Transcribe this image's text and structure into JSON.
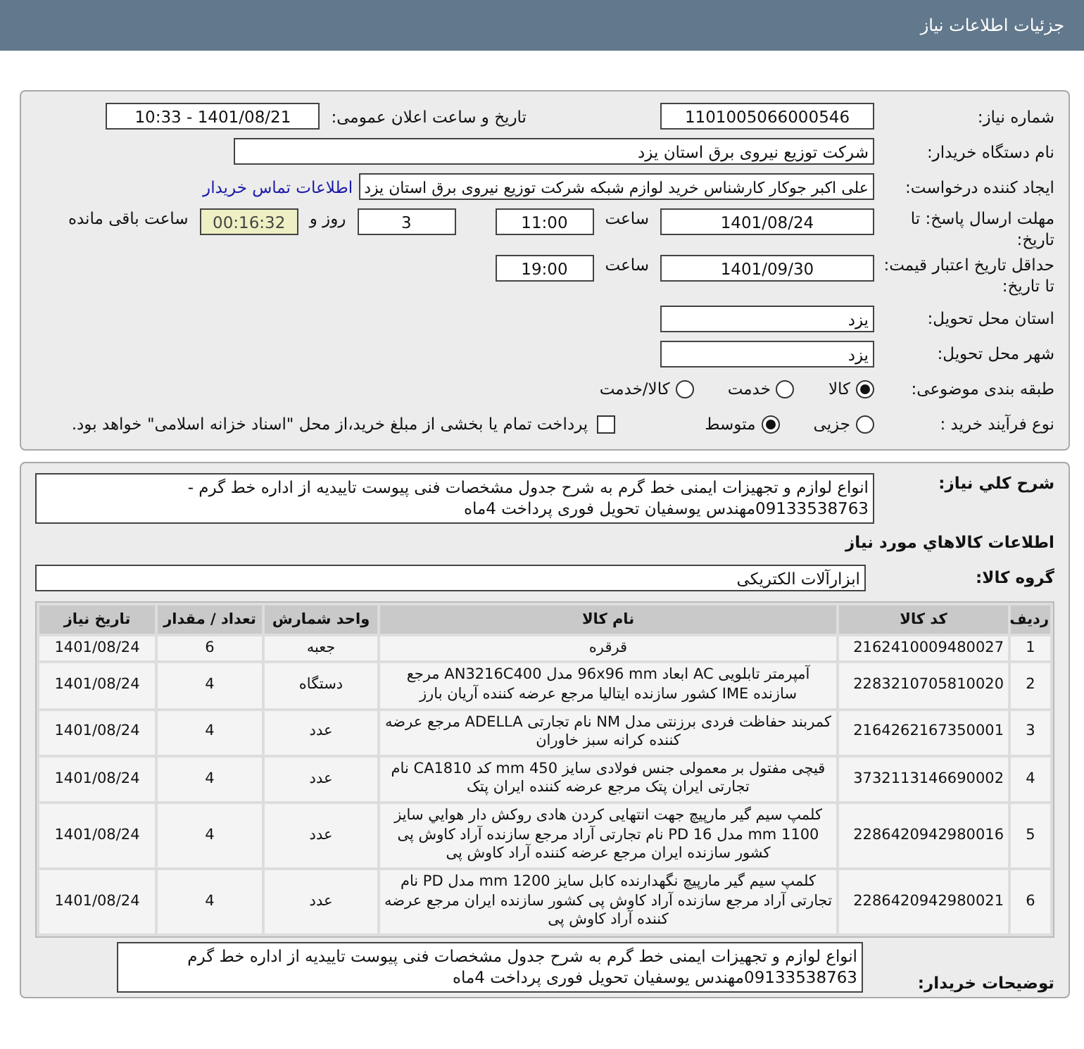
{
  "header": {
    "title": "جزئیات اطلاعات نیاز"
  },
  "need_number": {
    "label": "شماره نیاز:",
    "value": "1101005066000546"
  },
  "announce": {
    "label": "تاریخ و ساعت اعلان عمومی:",
    "value": "1401/08/21 - 10:33"
  },
  "buyer_org": {
    "label": "نام دستگاه خریدار:",
    "value": "شرکت توزیع نیروی برق استان یزد"
  },
  "requester": {
    "label": "ایجاد کننده درخواست:",
    "value": "علی اکبر  جوکار  کارشناس خرید لوازم شبکه  شرکت توزیع نیروی برق استان یزد",
    "link": "اطلاعات تماس خریدار"
  },
  "deadline": {
    "label": "مهلت ارسال پاسخ: تا تاریخ:",
    "date": "1401/08/24",
    "time_label": "ساعت",
    "time": "11:00",
    "days": "3",
    "days_label": "روز و",
    "remaining": "00:16:32",
    "remaining_label": "ساعت باقی مانده"
  },
  "validity": {
    "label": "حداقل تاریخ اعتبار قیمت: تا تاریخ:",
    "date": "1401/09/30",
    "time_label": "ساعت",
    "time": "19:00"
  },
  "province": {
    "label": "استان محل تحویل:",
    "value": "یزد"
  },
  "city": {
    "label": "شهر محل تحویل:",
    "value": "یزد"
  },
  "category": {
    "label": "طبقه بندی موضوعی:",
    "options": [
      {
        "label": "کالا",
        "selected": true
      },
      {
        "label": "خدمت",
        "selected": false
      },
      {
        "label": "کالا/خدمت",
        "selected": false
      }
    ]
  },
  "process": {
    "label": "نوع فرآیند خرید :",
    "options": [
      {
        "label": "جزیی",
        "selected": false
      },
      {
        "label": "متوسط",
        "selected": true
      }
    ],
    "treasury": {
      "checked": false,
      "text": "پرداخت تمام یا بخشی از مبلغ خرید،از محل \"اسناد خزانه اسلامی\" خواهد بود."
    }
  },
  "description": {
    "label": "شرح كلي نياز:",
    "value": "انواع لوازم و تجهیزات ایمنی خط گرم  به شرح جدول مشخصات فنی پیوست  تاییدیه از اداره خط گرم - 09133538763مهندس یوسفیان تحویل فوری پرداخت 4ماه"
  },
  "goods_title": "اطلاعات كالاهاي مورد نياز",
  "goods_group": {
    "label": "گروه کالا:",
    "value": "ابزارآلات الکتریکی"
  },
  "table": {
    "columns": [
      "ردیف",
      "کد کالا",
      "نام کالا",
      "واحد شمارش",
      "تعداد / مقدار",
      "تاریخ نیاز"
    ],
    "rows": [
      [
        "1",
        "2162410009480027",
        "قرقره",
        "جعبه",
        "6",
        "1401/08/24"
      ],
      [
        "2",
        "2283210705810020",
        "آمپرمتر تابلویی AC ابعاد 96x96 mm مدل AN3216C400 مرجع سازنده IME کشور سازنده ایتالیا مرجع عرضه کننده آریان بارز",
        "دستگاه",
        "4",
        "1401/08/24"
      ],
      [
        "3",
        "2164262167350001",
        "کمربند حفاظت فردی برزنتی مدل NM نام تجارتی ADELLA مرجع عرضه کننده کرانه سبز خاوران",
        "عدد",
        "4",
        "1401/08/24"
      ],
      [
        "4",
        "3732113146690002",
        "قیچی مفتول بر معمولی جنس فولادی سایز 450 mm کد CA1810 نام تجارتی ایران پتک مرجع عرضه کننده ایران پتک",
        "عدد",
        "4",
        "1401/08/24"
      ],
      [
        "5",
        "2286420942980016",
        "کلمپ سیم گیر مارپیچ جهت انتهایی کردن هادی روکش دار هوایي سایز 1100 mm مدل PD 16 نام تجارتی آراد مرجع سازنده آراد کاوش پی کشور سازنده ایران مرجع عرضه کننده آراد کاوش پی",
        "عدد",
        "4",
        "1401/08/24"
      ],
      [
        "6",
        "2286420942980021",
        "کلمپ سیم گیر مارپیچ نگهدارنده کابل سایز 1200 mm مدل PD نام تجارتی آراد مرجع سازنده آراد کاوش پی کشور سازنده ایران مرجع عرضه کننده آراد کاوش پی",
        "عدد",
        "4",
        "1401/08/24"
      ]
    ]
  },
  "buyer_notes": {
    "label": "توضیحات خریدار:",
    "value": "انواع لوازم و تجهیزات ایمنی خط گرم  به شرح جدول مشخصات فنی پیوست  تاییدیه از اداره خط گرم 09133538763مهندس یوسفیان تحویل فوری پرداخت 4ماه"
  }
}
